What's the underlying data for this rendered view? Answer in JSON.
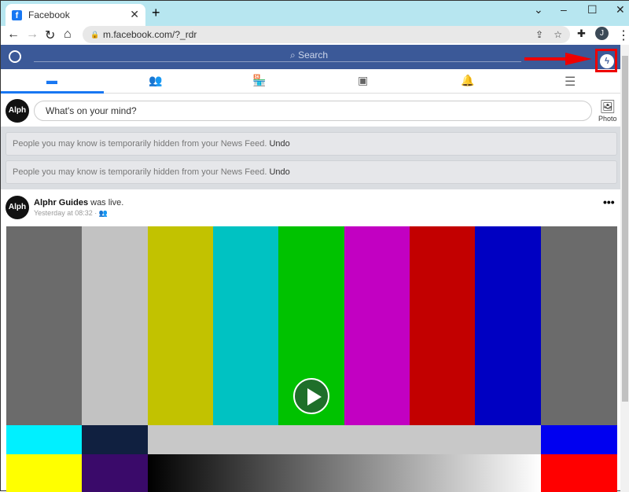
{
  "browser": {
    "tab_title": "Facebook",
    "url": "m.facebook.com/?_rdr",
    "profile_initial": "J"
  },
  "header": {
    "search_placeholder": "Search"
  },
  "composer": {
    "placeholder": "What's on your mind?",
    "photo_label": "Photo",
    "avatar_text": "Alph"
  },
  "notices": [
    {
      "text": "People you may know is temporarily hidden from your News Feed.",
      "action": "Undo"
    },
    {
      "text": "People you may know is temporarily hidden from your News Feed.",
      "action": "Undo"
    }
  ],
  "post": {
    "author": "Alphr Guides",
    "action": " was live.",
    "time": "Yesterday at 08:32 ·",
    "avatar_text": "Alph"
  },
  "colors": {
    "fb_blue": "#3b5998",
    "highlight": "#ee0000"
  }
}
